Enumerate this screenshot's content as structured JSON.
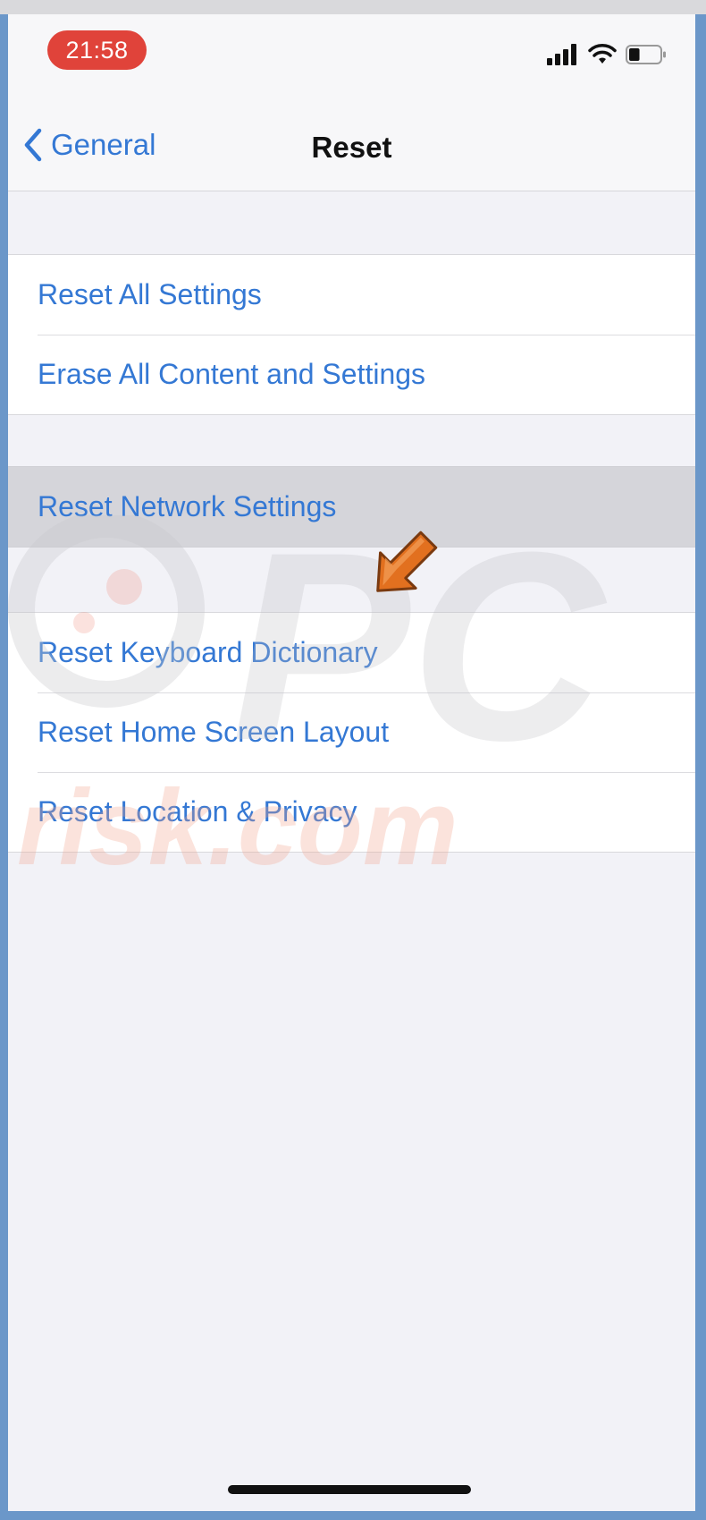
{
  "status_bar": {
    "time": "21:58",
    "battery_level": 0.35
  },
  "nav": {
    "back_label": "General",
    "title": "Reset"
  },
  "groups": [
    {
      "items": [
        {
          "label": "Reset All Settings"
        },
        {
          "label": "Erase All Content and Settings"
        }
      ]
    },
    {
      "items": [
        {
          "label": "Reset Network Settings",
          "highlighted": true
        }
      ]
    },
    {
      "items": [
        {
          "label": "Reset Keyboard Dictionary"
        },
        {
          "label": "Reset Home Screen Layout"
        },
        {
          "label": "Reset Location & Privacy"
        }
      ]
    }
  ],
  "watermark": {
    "text_top": "PC",
    "text_bottom": "risk.com"
  },
  "colors": {
    "accent": "#3478d4",
    "time_pill": "#e0433a",
    "arrow": "#e2701f",
    "frame": "#6b97c9"
  }
}
